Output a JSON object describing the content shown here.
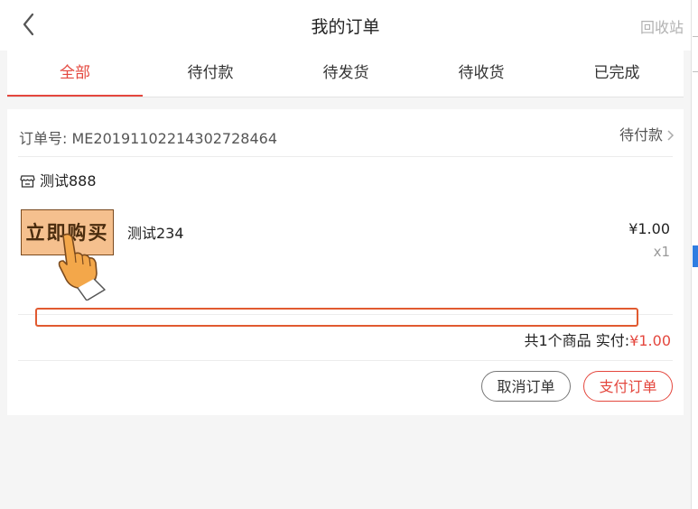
{
  "header": {
    "title": "我的订单",
    "recycle_label": "回收站",
    "back_icon": "chevron-left-icon"
  },
  "tabs": [
    {
      "label": "全部",
      "active": true
    },
    {
      "label": "待付款",
      "active": false
    },
    {
      "label": "待发货",
      "active": false
    },
    {
      "label": "待收货",
      "active": false
    },
    {
      "label": "已完成",
      "active": false
    }
  ],
  "order": {
    "order_no_label": "订单号:",
    "order_no": "ME20191102214302728464",
    "status": "待付款",
    "shop_icon": "store-icon",
    "shop_name": "测试888",
    "product": {
      "thumbnail_text": "立即购买",
      "name": "测试234",
      "price": "¥1.00",
      "qty": "x1"
    },
    "summary": {
      "count_text": "共1个商品",
      "paid_label": "实付:",
      "paid_amount": "¥1.00"
    },
    "buttons": {
      "cancel": "取消订单",
      "pay": "支付订单"
    }
  },
  "colors": {
    "accent": "#e4473e",
    "highlight_box": "#e15a30",
    "rail_indicator": "#2f7de1"
  }
}
